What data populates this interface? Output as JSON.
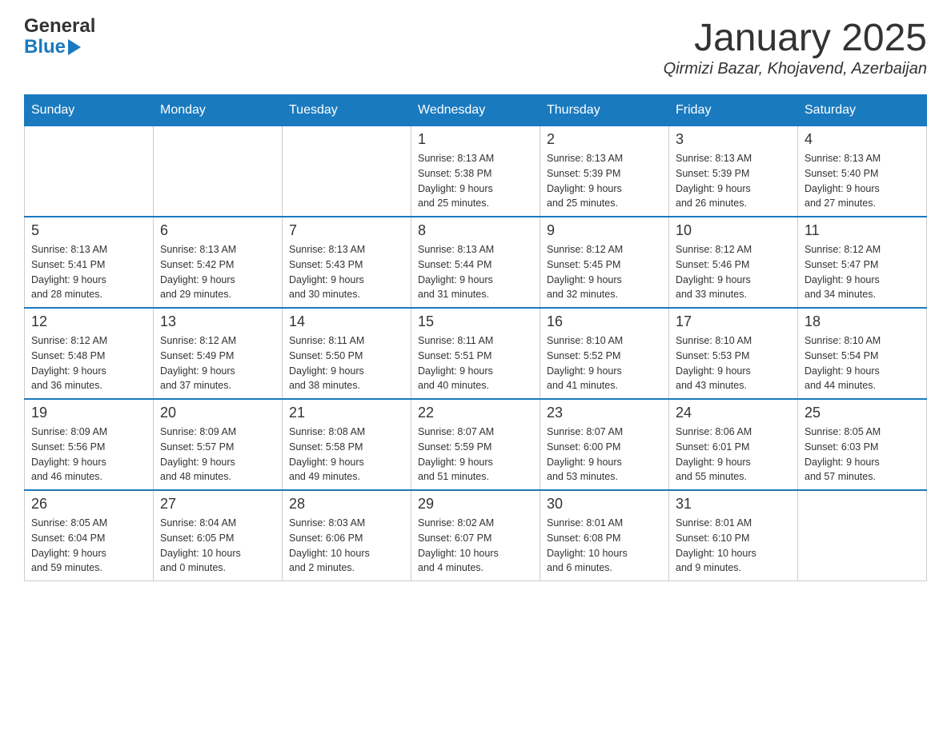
{
  "header": {
    "logo": {
      "general": "General",
      "blue": "Blue"
    },
    "title": "January 2025",
    "subtitle": "Qirmizi Bazar, Khojavend, Azerbaijan"
  },
  "weekdays": [
    "Sunday",
    "Monday",
    "Tuesday",
    "Wednesday",
    "Thursday",
    "Friday",
    "Saturday"
  ],
  "weeks": [
    [
      {
        "day": "",
        "info": ""
      },
      {
        "day": "",
        "info": ""
      },
      {
        "day": "",
        "info": ""
      },
      {
        "day": "1",
        "info": "Sunrise: 8:13 AM\nSunset: 5:38 PM\nDaylight: 9 hours\nand 25 minutes."
      },
      {
        "day": "2",
        "info": "Sunrise: 8:13 AM\nSunset: 5:39 PM\nDaylight: 9 hours\nand 25 minutes."
      },
      {
        "day": "3",
        "info": "Sunrise: 8:13 AM\nSunset: 5:39 PM\nDaylight: 9 hours\nand 26 minutes."
      },
      {
        "day": "4",
        "info": "Sunrise: 8:13 AM\nSunset: 5:40 PM\nDaylight: 9 hours\nand 27 minutes."
      }
    ],
    [
      {
        "day": "5",
        "info": "Sunrise: 8:13 AM\nSunset: 5:41 PM\nDaylight: 9 hours\nand 28 minutes."
      },
      {
        "day": "6",
        "info": "Sunrise: 8:13 AM\nSunset: 5:42 PM\nDaylight: 9 hours\nand 29 minutes."
      },
      {
        "day": "7",
        "info": "Sunrise: 8:13 AM\nSunset: 5:43 PM\nDaylight: 9 hours\nand 30 minutes."
      },
      {
        "day": "8",
        "info": "Sunrise: 8:13 AM\nSunset: 5:44 PM\nDaylight: 9 hours\nand 31 minutes."
      },
      {
        "day": "9",
        "info": "Sunrise: 8:12 AM\nSunset: 5:45 PM\nDaylight: 9 hours\nand 32 minutes."
      },
      {
        "day": "10",
        "info": "Sunrise: 8:12 AM\nSunset: 5:46 PM\nDaylight: 9 hours\nand 33 minutes."
      },
      {
        "day": "11",
        "info": "Sunrise: 8:12 AM\nSunset: 5:47 PM\nDaylight: 9 hours\nand 34 minutes."
      }
    ],
    [
      {
        "day": "12",
        "info": "Sunrise: 8:12 AM\nSunset: 5:48 PM\nDaylight: 9 hours\nand 36 minutes."
      },
      {
        "day": "13",
        "info": "Sunrise: 8:12 AM\nSunset: 5:49 PM\nDaylight: 9 hours\nand 37 minutes."
      },
      {
        "day": "14",
        "info": "Sunrise: 8:11 AM\nSunset: 5:50 PM\nDaylight: 9 hours\nand 38 minutes."
      },
      {
        "day": "15",
        "info": "Sunrise: 8:11 AM\nSunset: 5:51 PM\nDaylight: 9 hours\nand 40 minutes."
      },
      {
        "day": "16",
        "info": "Sunrise: 8:10 AM\nSunset: 5:52 PM\nDaylight: 9 hours\nand 41 minutes."
      },
      {
        "day": "17",
        "info": "Sunrise: 8:10 AM\nSunset: 5:53 PM\nDaylight: 9 hours\nand 43 minutes."
      },
      {
        "day": "18",
        "info": "Sunrise: 8:10 AM\nSunset: 5:54 PM\nDaylight: 9 hours\nand 44 minutes."
      }
    ],
    [
      {
        "day": "19",
        "info": "Sunrise: 8:09 AM\nSunset: 5:56 PM\nDaylight: 9 hours\nand 46 minutes."
      },
      {
        "day": "20",
        "info": "Sunrise: 8:09 AM\nSunset: 5:57 PM\nDaylight: 9 hours\nand 48 minutes."
      },
      {
        "day": "21",
        "info": "Sunrise: 8:08 AM\nSunset: 5:58 PM\nDaylight: 9 hours\nand 49 minutes."
      },
      {
        "day": "22",
        "info": "Sunrise: 8:07 AM\nSunset: 5:59 PM\nDaylight: 9 hours\nand 51 minutes."
      },
      {
        "day": "23",
        "info": "Sunrise: 8:07 AM\nSunset: 6:00 PM\nDaylight: 9 hours\nand 53 minutes."
      },
      {
        "day": "24",
        "info": "Sunrise: 8:06 AM\nSunset: 6:01 PM\nDaylight: 9 hours\nand 55 minutes."
      },
      {
        "day": "25",
        "info": "Sunrise: 8:05 AM\nSunset: 6:03 PM\nDaylight: 9 hours\nand 57 minutes."
      }
    ],
    [
      {
        "day": "26",
        "info": "Sunrise: 8:05 AM\nSunset: 6:04 PM\nDaylight: 9 hours\nand 59 minutes."
      },
      {
        "day": "27",
        "info": "Sunrise: 8:04 AM\nSunset: 6:05 PM\nDaylight: 10 hours\nand 0 minutes."
      },
      {
        "day": "28",
        "info": "Sunrise: 8:03 AM\nSunset: 6:06 PM\nDaylight: 10 hours\nand 2 minutes."
      },
      {
        "day": "29",
        "info": "Sunrise: 8:02 AM\nSunset: 6:07 PM\nDaylight: 10 hours\nand 4 minutes."
      },
      {
        "day": "30",
        "info": "Sunrise: 8:01 AM\nSunset: 6:08 PM\nDaylight: 10 hours\nand 6 minutes."
      },
      {
        "day": "31",
        "info": "Sunrise: 8:01 AM\nSunset: 6:10 PM\nDaylight: 10 hours\nand 9 minutes."
      },
      {
        "day": "",
        "info": ""
      }
    ]
  ]
}
